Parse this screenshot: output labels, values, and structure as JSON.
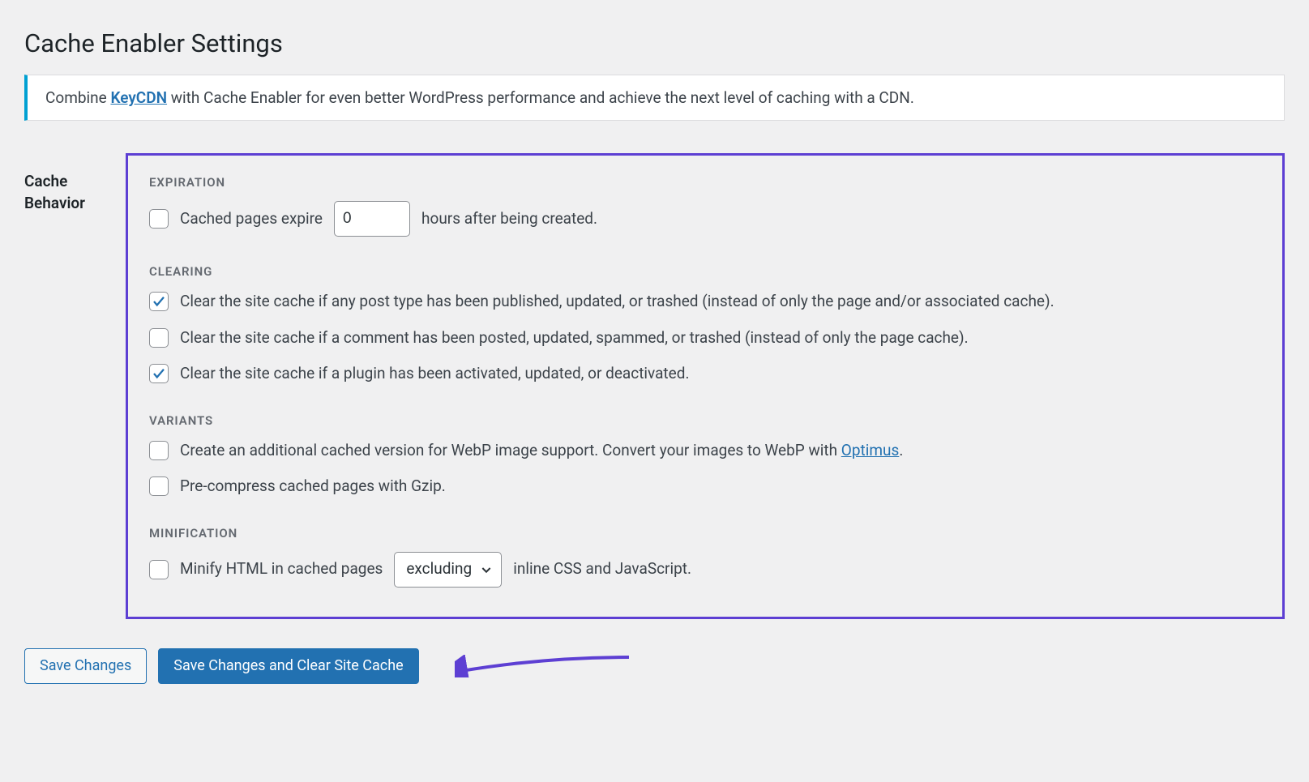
{
  "page_title": "Cache Enabler Settings",
  "banner": {
    "pre": "Combine ",
    "link": "KeyCDN",
    "post": " with Cache Enabler for even better WordPress performance and achieve the next level of caching with a CDN."
  },
  "sidebar_label": "Cache Behavior",
  "groups": {
    "expiration": {
      "title": "EXPIRATION",
      "row": {
        "pre": "Cached pages expire",
        "value": "0",
        "post": "hours after being created."
      }
    },
    "clearing": {
      "title": "CLEARING",
      "items": [
        "Clear the site cache if any post type has been published, updated, or trashed (instead of only the page and/or associated cache).",
        "Clear the site cache if a comment has been posted, updated, spammed, or trashed (instead of only the page cache).",
        "Clear the site cache if a plugin has been activated, updated, or deactivated."
      ]
    },
    "variants": {
      "title": "VARIANTS",
      "item0pre": "Create an additional cached version for WebP image support. Convert your images to WebP with ",
      "item0link": "Optimus",
      "item0post": ".",
      "item1": "Pre-compress cached pages with Gzip."
    },
    "minification": {
      "title": "MINIFICATION",
      "pre": "Minify HTML in cached pages",
      "select": "excluding",
      "post": "inline CSS and JavaScript."
    }
  },
  "buttons": {
    "save": "Save Changes",
    "save_clear": "Save Changes and Clear Site Cache"
  }
}
